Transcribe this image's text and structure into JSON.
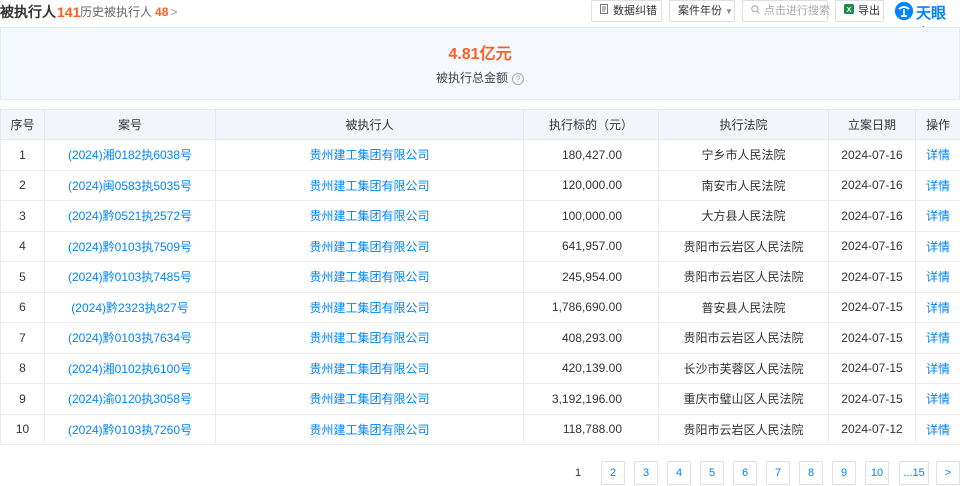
{
  "header": {
    "title": "被执行人",
    "count": "141",
    "history_label": "历史被执行人",
    "history_count": "48",
    "history_chevron": ">",
    "btn_correct": "数据纠错",
    "btn_year": "案件年份",
    "search_placeholder": "点击进行搜索",
    "btn_export": "导出",
    "brand": "天眼查"
  },
  "summary": {
    "amount": "4.81亿元",
    "label": "被执行总金额",
    "help_glyph": "?"
  },
  "table": {
    "columns": [
      "序号",
      "案号",
      "被执行人",
      "执行标的（元）",
      "执行法院",
      "立案日期",
      "操作"
    ],
    "rows": [
      {
        "no": "1",
        "case": "(2024)湘0182执6038号",
        "party": "贵州建工集团有限公司",
        "amount": "180,427.00",
        "court": "宁乡市人民法院",
        "date": "2024-07-16",
        "op": "详情"
      },
      {
        "no": "2",
        "case": "(2024)闽0583执5035号",
        "party": "贵州建工集团有限公司",
        "amount": "120,000.00",
        "court": "南安市人民法院",
        "date": "2024-07-16",
        "op": "详情"
      },
      {
        "no": "3",
        "case": "(2024)黔0521执2572号",
        "party": "贵州建工集团有限公司",
        "amount": "100,000.00",
        "court": "大方县人民法院",
        "date": "2024-07-16",
        "op": "详情"
      },
      {
        "no": "4",
        "case": "(2024)黔0103执7509号",
        "party": "贵州建工集团有限公司",
        "amount": "641,957.00",
        "court": "贵阳市云岩区人民法院",
        "date": "2024-07-16",
        "op": "详情"
      },
      {
        "no": "5",
        "case": "(2024)黔0103执7485号",
        "party": "贵州建工集团有限公司",
        "amount": "245,954.00",
        "court": "贵阳市云岩区人民法院",
        "date": "2024-07-15",
        "op": "详情"
      },
      {
        "no": "6",
        "case": "(2024)黔2323执827号",
        "party": "贵州建工集团有限公司",
        "amount": "1,786,690.00",
        "court": "普安县人民法院",
        "date": "2024-07-15",
        "op": "详情"
      },
      {
        "no": "7",
        "case": "(2024)黔0103执7634号",
        "party": "贵州建工集团有限公司",
        "amount": "408,293.00",
        "court": "贵阳市云岩区人民法院",
        "date": "2024-07-15",
        "op": "详情"
      },
      {
        "no": "8",
        "case": "(2024)湘0102执6100号",
        "party": "贵州建工集团有限公司",
        "amount": "420,139.00",
        "court": "长沙市芙蓉区人民法院",
        "date": "2024-07-15",
        "op": "详情"
      },
      {
        "no": "9",
        "case": "(2024)渝0120执3058号",
        "party": "贵州建工集团有限公司",
        "amount": "3,192,196.00",
        "court": "重庆市璧山区人民法院",
        "date": "2024-07-15",
        "op": "详情"
      },
      {
        "no": "10",
        "case": "(2024)黔0103执7260号",
        "party": "贵州建工集团有限公司",
        "amount": "118,788.00",
        "court": "贵阳市云岩区人民法院",
        "date": "2024-07-12",
        "op": "详情"
      }
    ]
  },
  "pagination": {
    "current": "1",
    "pages": [
      "2",
      "3",
      "4",
      "5",
      "6",
      "7",
      "8",
      "9",
      "10"
    ],
    "last": "...15",
    "next": ">"
  }
}
